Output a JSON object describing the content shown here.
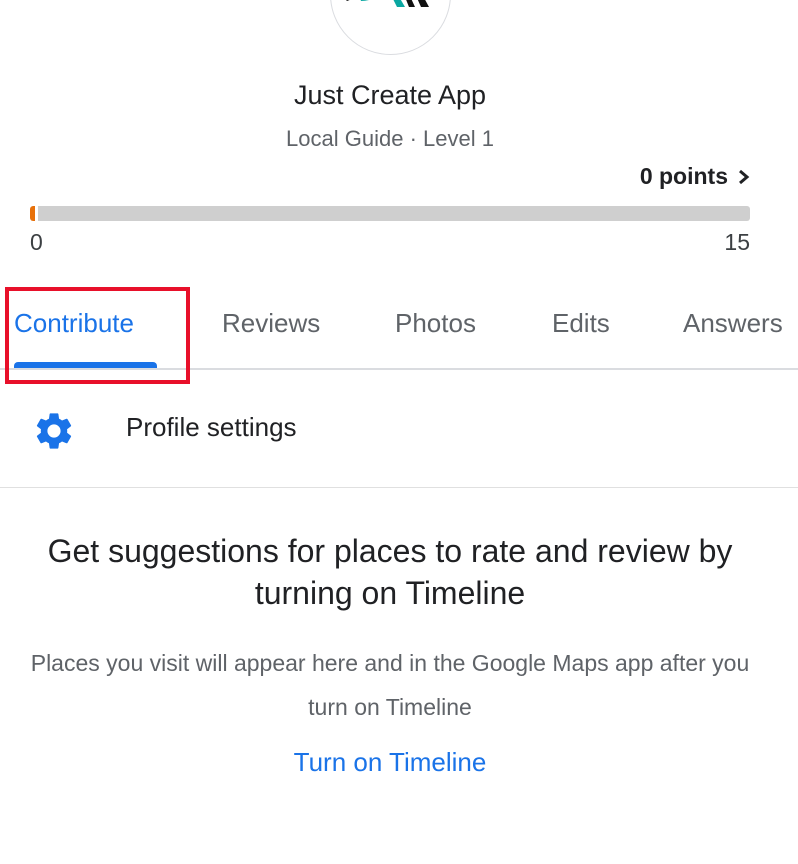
{
  "profile": {
    "name": "Just Create App",
    "level": "Local Guide · Level 1",
    "avatar_icon": "just-create-app-logo"
  },
  "points": {
    "label": "0 points",
    "chevron_icon": "chevron-right-icon"
  },
  "progress": {
    "current": 0,
    "min_label": "0",
    "max_label": "15",
    "max": 15,
    "fill_color": "#e8710a"
  },
  "tabs": [
    {
      "label": "Contribute",
      "active": true
    },
    {
      "label": "Reviews",
      "active": false
    },
    {
      "label": "Photos",
      "active": false
    },
    {
      "label": "Edits",
      "active": false
    },
    {
      "label": "Answers",
      "active": false
    }
  ],
  "settings": {
    "label": "Profile settings",
    "icon": "gear-icon"
  },
  "empty_state": {
    "title": "Get suggestions for places to rate and review by turning on Timeline",
    "description": "Places you visit will appear here and in the Google Maps app after you turn on Timeline",
    "link": "Turn on Timeline"
  },
  "colors": {
    "accent": "#1a73e8",
    "highlight": "#e8102a",
    "progress_fill": "#e8710a"
  }
}
